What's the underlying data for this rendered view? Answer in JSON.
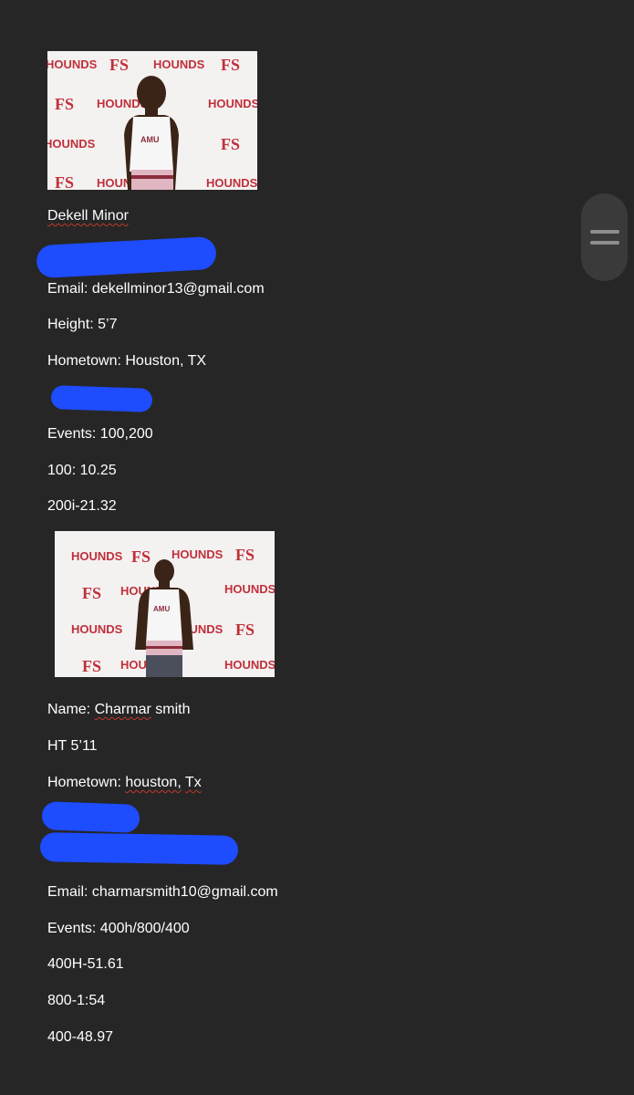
{
  "athlete1": {
    "name": "Dekell Minor",
    "email": "Email: dekellminor13@gmail.com",
    "height": "Height: 5’7",
    "hometown": "Hometown: Houston, TX",
    "events": "Events: 100,200",
    "pr_100": "100: 10.25",
    "pr_200i": "200i-21.32"
  },
  "athlete2": {
    "name_label": "Name: ",
    "name_first": "Charmar",
    "name_last": " smith",
    "height": "HT 5’11",
    "hometown_label": "Hometown: ",
    "hometown_city": "houston,",
    "hometown_space": " ",
    "hometown_state": "Tx",
    "email": "Email: charmarsmith10@gmail.com",
    "events": "Events: 400h/800/400",
    "pr_400h": "400H-51.61",
    "pr_800": "800-1:54",
    "pr_400": "400-48.97"
  },
  "backdrop": {
    "word": "HOUNDS",
    "monogram": "FS",
    "singlet_text": "AMU"
  },
  "colors": {
    "background": "#262626",
    "text": "#ffffff",
    "redaction": "#1e4cff",
    "backdrop_red": "#c0303a"
  },
  "icons": {
    "scroll": "drag-handle-icon"
  }
}
